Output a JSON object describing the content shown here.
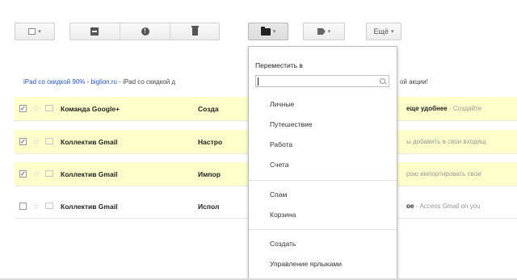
{
  "toolbar": {
    "more_label": "Ещё",
    "caret": "▾"
  },
  "ad": {
    "link1": "iPad со скидкой 90%",
    "dash1": " - ",
    "link2": "biglion.ru",
    "text": " - iPad со скидкой д",
    "tail": "ой акции!"
  },
  "messages": [
    {
      "selected": true,
      "sender": "Команда Google+",
      "subject": "Созда",
      "right_bold": "еще удобнее",
      "right_snippet": " - Создайте"
    },
    {
      "selected": true,
      "sender": "Коллектив Gmail",
      "subject": "Настро",
      "right_bold": "",
      "right_snippet": "ы добавить в свои входящ"
    },
    {
      "selected": true,
      "sender": "Коллектив Gmail",
      "subject": "Импор",
      "right_bold": "",
      "right_snippet": "рою импортировать свои"
    },
    {
      "selected": false,
      "sender": "Коллектив Gmail",
      "subject": "Испол",
      "right_bold": "ое",
      "right_snippet": " - Access Gmail on you"
    }
  ],
  "check_mark": "✓",
  "star_glyph": "☆",
  "move_menu": {
    "title": "Переместить в",
    "search_value": "",
    "labels": [
      "Личные",
      "Путешествие",
      "Работа",
      "Счета"
    ],
    "system": [
      "Спам",
      "Корзина"
    ],
    "actions": [
      "Создать",
      "Управление ярлыками"
    ]
  },
  "icons": {
    "select": "checkbox-icon",
    "archive": "archive-icon",
    "spam": "spam-icon",
    "delete": "trash-icon",
    "move": "folder-icon",
    "labels": "tag-icon",
    "search": "search-icon",
    "star": "star-icon",
    "important": "important-marker-icon"
  },
  "colors": {
    "selected_row": "#ffffcc",
    "link": "#2255bb"
  }
}
